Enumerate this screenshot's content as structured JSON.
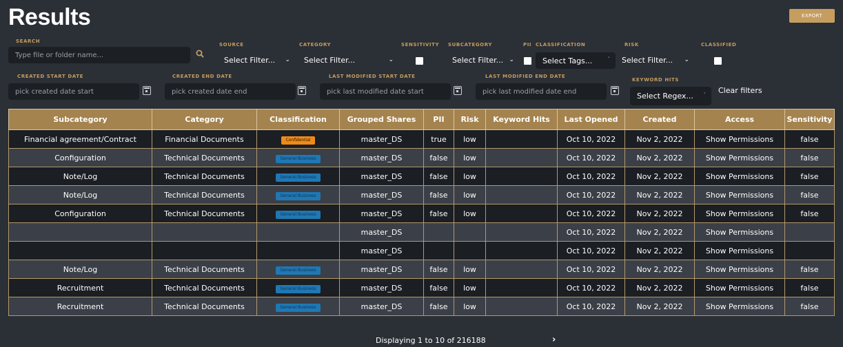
{
  "header": {
    "title": "Results",
    "export_label": "EXPORT"
  },
  "filters": {
    "search": {
      "label": "SEARCH",
      "placeholder": "Type file or folder name..."
    },
    "source": {
      "label": "SOURCE",
      "value": "Select Filter..."
    },
    "category": {
      "label": "CATEGORY",
      "value": "Select Filter..."
    },
    "sensitivity": {
      "label": "SENSITIVITY"
    },
    "subcategory": {
      "label": "SUBCATEGORY",
      "value": "Select Filter..."
    },
    "pii": {
      "label": "PII"
    },
    "classification": {
      "label": "CLASSIFICATION",
      "value": "Select Tags..."
    },
    "risk": {
      "label": "RISK",
      "value": "Select Filter..."
    },
    "classified": {
      "label": "CLASSIFIED"
    },
    "created_start": {
      "label": "CREATED START DATE",
      "placeholder": "pick created date start"
    },
    "created_end": {
      "label": "CREATED END DATE",
      "placeholder": "pick created date end"
    },
    "modified_start": {
      "label": "LAST MODIFIED START DATE",
      "placeholder": "pick last modified date start"
    },
    "modified_end": {
      "label": "LAST MODIFIED END DATE",
      "placeholder": "pick last modified date end"
    },
    "keyword_hits": {
      "label": "KEYWORD HITS",
      "value": "Select Regex..."
    },
    "clear_label": "Clear filters"
  },
  "table": {
    "columns": [
      "Subcategory",
      "Category",
      "Classification",
      "Grouped Shares",
      "PII",
      "Risk",
      "Keyword Hits",
      "Last Opened",
      "Created",
      "Access",
      "Sensitivity"
    ],
    "rows": [
      {
        "subcategory": "Financial agreement/Contract",
        "category": "Financial Documents",
        "classification": "Confidential",
        "shares": "master_DS",
        "pii": "true",
        "risk": "low",
        "keyword_hits": "",
        "last_opened": "Oct 10, 2022",
        "created": "Nov 2, 2022",
        "access": "Show Permissions",
        "sensitivity": "false"
      },
      {
        "subcategory": "Configuration",
        "category": "Technical Documents",
        "classification": "General Business",
        "shares": "master_DS",
        "pii": "false",
        "risk": "low",
        "keyword_hits": "",
        "last_opened": "Oct 10, 2022",
        "created": "Nov 2, 2022",
        "access": "Show Permissions",
        "sensitivity": "false"
      },
      {
        "subcategory": "Note/Log",
        "category": "Technical Documents",
        "classification": "General Business",
        "shares": "master_DS",
        "pii": "false",
        "risk": "low",
        "keyword_hits": "",
        "last_opened": "Oct 10, 2022",
        "created": "Nov 2, 2022",
        "access": "Show Permissions",
        "sensitivity": "false"
      },
      {
        "subcategory": "Note/Log",
        "category": "Technical Documents",
        "classification": "General Business",
        "shares": "master_DS",
        "pii": "false",
        "risk": "low",
        "keyword_hits": "",
        "last_opened": "Oct 10, 2022",
        "created": "Nov 2, 2022",
        "access": "Show Permissions",
        "sensitivity": "false"
      },
      {
        "subcategory": "Configuration",
        "category": "Technical Documents",
        "classification": "General Business",
        "shares": "master_DS",
        "pii": "false",
        "risk": "low",
        "keyword_hits": "",
        "last_opened": "Oct 10, 2022",
        "created": "Nov 2, 2022",
        "access": "Show Permissions",
        "sensitivity": "false"
      },
      {
        "subcategory": "",
        "category": "",
        "classification": "",
        "shares": "master_DS",
        "pii": "",
        "risk": "",
        "keyword_hits": "",
        "last_opened": "Oct 10, 2022",
        "created": "Nov 2, 2022",
        "access": "Show Permissions",
        "sensitivity": ""
      },
      {
        "subcategory": "",
        "category": "",
        "classification": "",
        "shares": "master_DS",
        "pii": "",
        "risk": "",
        "keyword_hits": "",
        "last_opened": "Oct 10, 2022",
        "created": "Nov 2, 2022",
        "access": "Show Permissions",
        "sensitivity": ""
      },
      {
        "subcategory": "Note/Log",
        "category": "Technical Documents",
        "classification": "General Business",
        "shares": "master_DS",
        "pii": "false",
        "risk": "low",
        "keyword_hits": "",
        "last_opened": "Oct 10, 2022",
        "created": "Nov 2, 2022",
        "access": "Show Permissions",
        "sensitivity": "false"
      },
      {
        "subcategory": "Recruitment",
        "category": "Technical Documents",
        "classification": "General Business",
        "shares": "master_DS",
        "pii": "false",
        "risk": "low",
        "keyword_hits": "",
        "last_opened": "Oct 10, 2022",
        "created": "Nov 2, 2022",
        "access": "Show Permissions",
        "sensitivity": "false"
      },
      {
        "subcategory": "Recruitment",
        "category": "Technical Documents",
        "classification": "General Business",
        "shares": "master_DS",
        "pii": "false",
        "risk": "low",
        "keyword_hits": "",
        "last_opened": "Oct 10, 2022",
        "created": "Nov 2, 2022",
        "access": "Show Permissions",
        "sensitivity": "false"
      }
    ]
  },
  "pagination": {
    "text": "Displaying 1 to 10 of 216188",
    "next_icon": "chevron-right-icon"
  },
  "colors": {
    "background": "#2b2f36",
    "accent": "#c59d5f",
    "header_row": "#a5834e",
    "confidential": "#ef8a17",
    "general_business": "#1f78b4"
  }
}
